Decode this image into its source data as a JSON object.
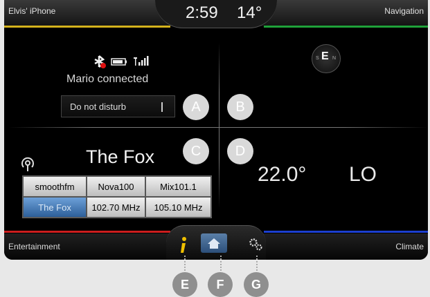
{
  "top_bar": {
    "left_label": "Elvis' iPhone",
    "time": "2:59",
    "outside_temp": "14°",
    "right_label": "Navigation"
  },
  "phone": {
    "status_text": "Mario connected",
    "dnd_label": "Do not disturb",
    "icons": [
      "bluetooth-icon",
      "battery-icon",
      "signal-icon"
    ]
  },
  "compass": {
    "heading": "E",
    "left_marker": "S",
    "right_marker": "N"
  },
  "markers": {
    "a": "A",
    "b": "B",
    "c": "C",
    "d": "D",
    "e": "E",
    "f": "F",
    "g": "G"
  },
  "audio": {
    "station_name": "The Fox",
    "presets": [
      [
        "smoothfm",
        "Nova100",
        "Mix101.1"
      ],
      [
        "The Fox",
        "102.70 MHz",
        "105.10 MHz"
      ]
    ],
    "selected_preset": "The Fox"
  },
  "climate": {
    "temperature": "22.0°",
    "fan": "LO"
  },
  "bottom_bar": {
    "left_label": "Entertainment",
    "right_label": "Climate"
  },
  "colors": {
    "phone_accent": "#d4b21c",
    "navigation_accent": "#1fa23a",
    "entertainment_accent": "#cc1e1e",
    "climate_accent": "#1c3fd0"
  }
}
